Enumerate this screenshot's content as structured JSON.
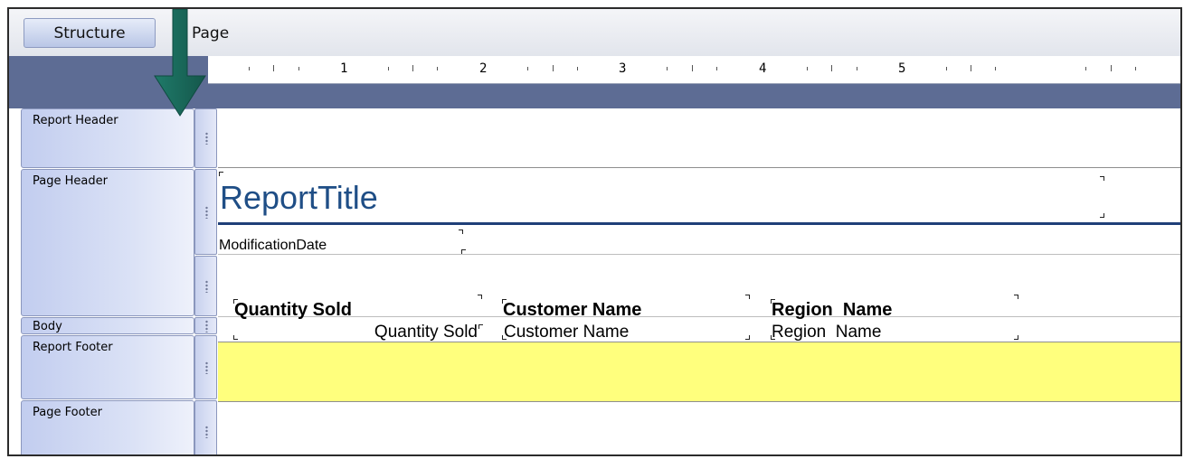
{
  "tabs": {
    "structure": "Structure",
    "page": "Page"
  },
  "ruler": {
    "numbers": [
      "1",
      "2",
      "3",
      "4",
      "5"
    ]
  },
  "sections": {
    "report_header": "Report Header",
    "page_header": "Page Header",
    "body": "Body",
    "report_footer": "Report Footer",
    "page_footer": "Page Footer"
  },
  "page_header": {
    "title": "ReportTitle",
    "modification_date": "ModificationDate",
    "columns": [
      "Quantity Sold",
      "Customer Name",
      "Region  Name"
    ]
  },
  "body_fields": [
    "Quantity Sold",
    "Customer Name",
    "Region  Name"
  ],
  "colors": {
    "section_band": "#5d6c94",
    "title": "#1f4e86",
    "report_footer_fill": "#ffff7d",
    "arrow": "#1b6a5c"
  },
  "annotation": {
    "icon": "arrow-down-icon"
  }
}
